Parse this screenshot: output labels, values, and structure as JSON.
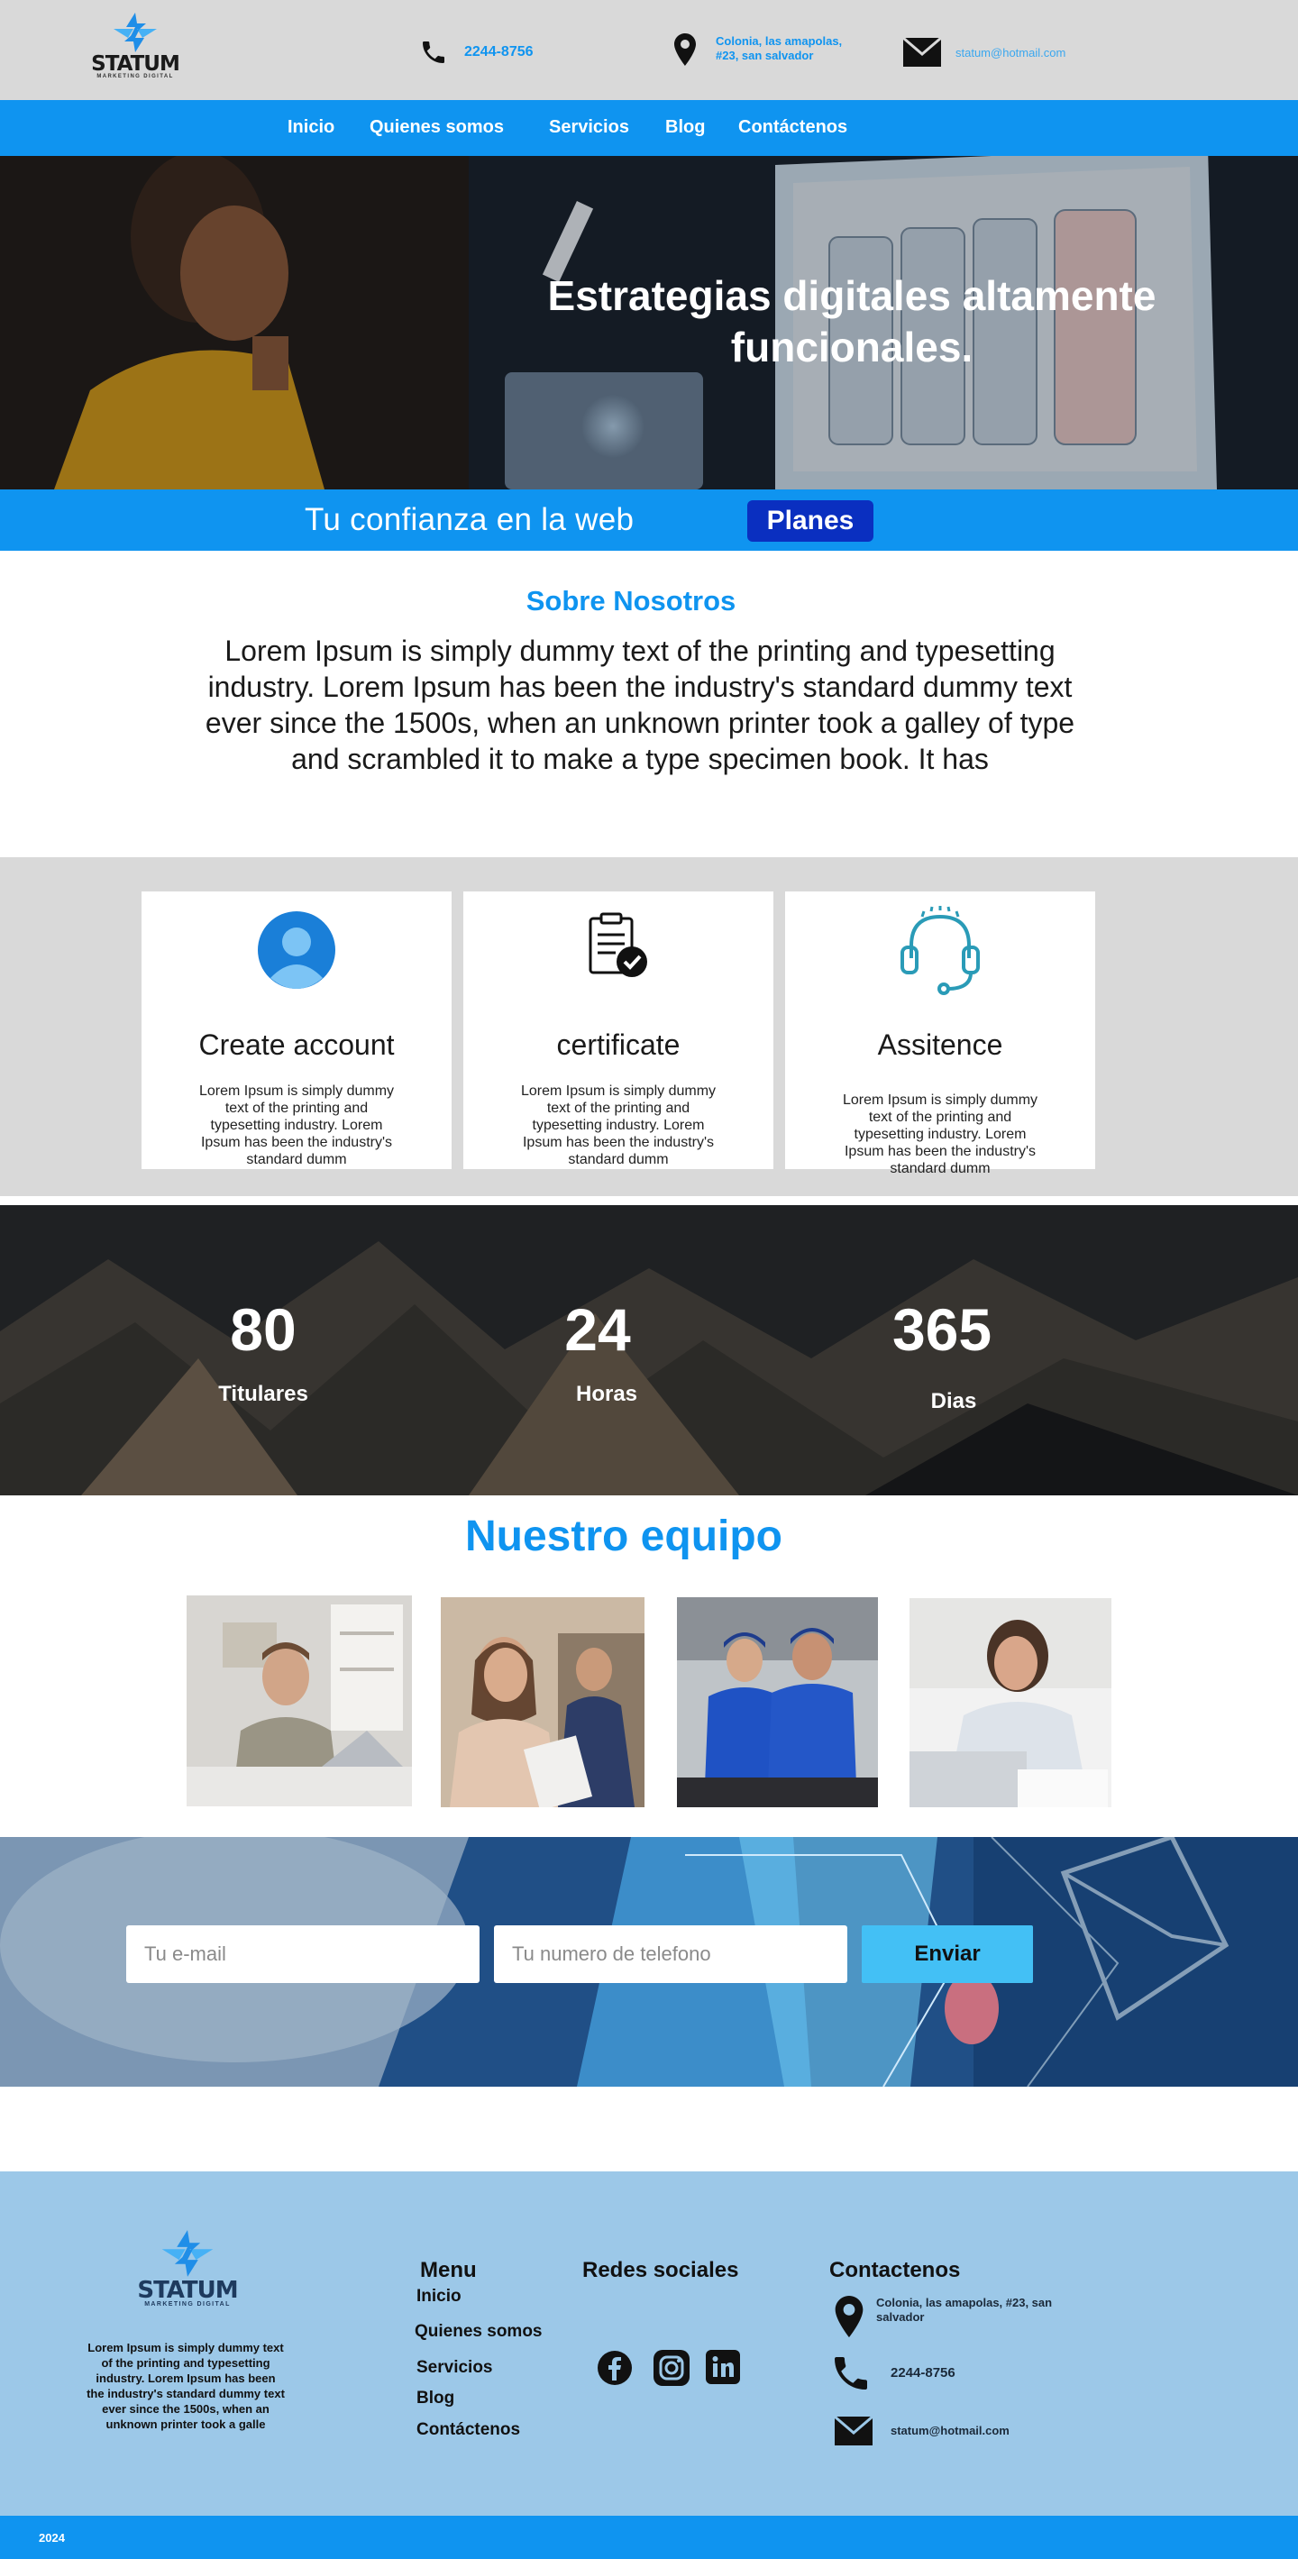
{
  "header": {
    "brand": "STATUM",
    "tagline": "MARKETING DIGITAL",
    "phone": "2244-8756",
    "address": "Colonia, las amapolas, #23, san salvador",
    "email": "statum@hotmail.com"
  },
  "nav": {
    "items": [
      {
        "label": "Inicio"
      },
      {
        "label": "Quienes somos"
      },
      {
        "label": "Servicios"
      },
      {
        "label": "Blog"
      },
      {
        "label": "Contáctenos"
      }
    ]
  },
  "hero": {
    "title": "Estrategias digitales altamente funcionales.",
    "band_text": "Tu confianza en la web",
    "band_button": "Planes"
  },
  "about": {
    "title": "Sobre Nosotros",
    "text": "Lorem Ipsum is simply dummy text of the printing and typesetting industry. Lorem Ipsum has been the industry's standard dummy text ever since the 1500s, when an unknown printer took a galley of type and scrambled it to make a type specimen book. It has"
  },
  "features": [
    {
      "title": "Create account",
      "text": "Lorem Ipsum is simply dummy text of the printing and typesetting industry. Lorem Ipsum has been the industry's standard dumm",
      "icon": "user-avatar-icon"
    },
    {
      "title": "certificate",
      "text": "Lorem Ipsum is simply dummy text of the printing and typesetting industry. Lorem Ipsum has been the industry's standard dumm",
      "icon": "certificate-icon"
    },
    {
      "title": "Assitence",
      "text": "Lorem Ipsum is simply dummy text of the printing and typesetting industry. Lorem Ipsum has been the industry's standard dumm",
      "icon": "headset-icon"
    }
  ],
  "stats": [
    {
      "value": "80",
      "label": "Titulares"
    },
    {
      "value": "24",
      "label": "Horas"
    },
    {
      "value": "365",
      "label": "Dias"
    }
  ],
  "team": {
    "title": "Nuestro equipo"
  },
  "subscribe": {
    "email_placeholder": "Tu e-mail",
    "phone_placeholder": "Tu numero de telefono",
    "button": "Enviar"
  },
  "footer": {
    "brand": "STATUM",
    "tagline": "MARKETING DIGITAL",
    "about": "Lorem Ipsum is simply dummy text of the printing and typesetting industry. Lorem Ipsum has been the industry's standard dummy text ever since the 1500s, when an unknown printer took a galle",
    "menu_title": "Menu",
    "menu": [
      {
        "label": "Inicio"
      },
      {
        "label": "Quienes somos"
      },
      {
        "label": "Servicios"
      },
      {
        "label": "Blog"
      },
      {
        "label": "Contáctenos"
      }
    ],
    "social_title": "Redes sociales",
    "social_icons": [
      "facebook-icon",
      "instagram-icon",
      "linkedin-icon"
    ],
    "contact_title": "Contactenos",
    "address": "Colonia, las amapolas, #23, san salvador",
    "phone": "2244-8756",
    "email": "statum@hotmail.com",
    "copyright": "2024"
  },
  "colors": {
    "primary": "#0f94f0",
    "dark_button": "#0a2fc0",
    "send_button": "#43c0f5",
    "footer_bg": "#9cc8e8",
    "header_bg": "#d9d9d9"
  }
}
